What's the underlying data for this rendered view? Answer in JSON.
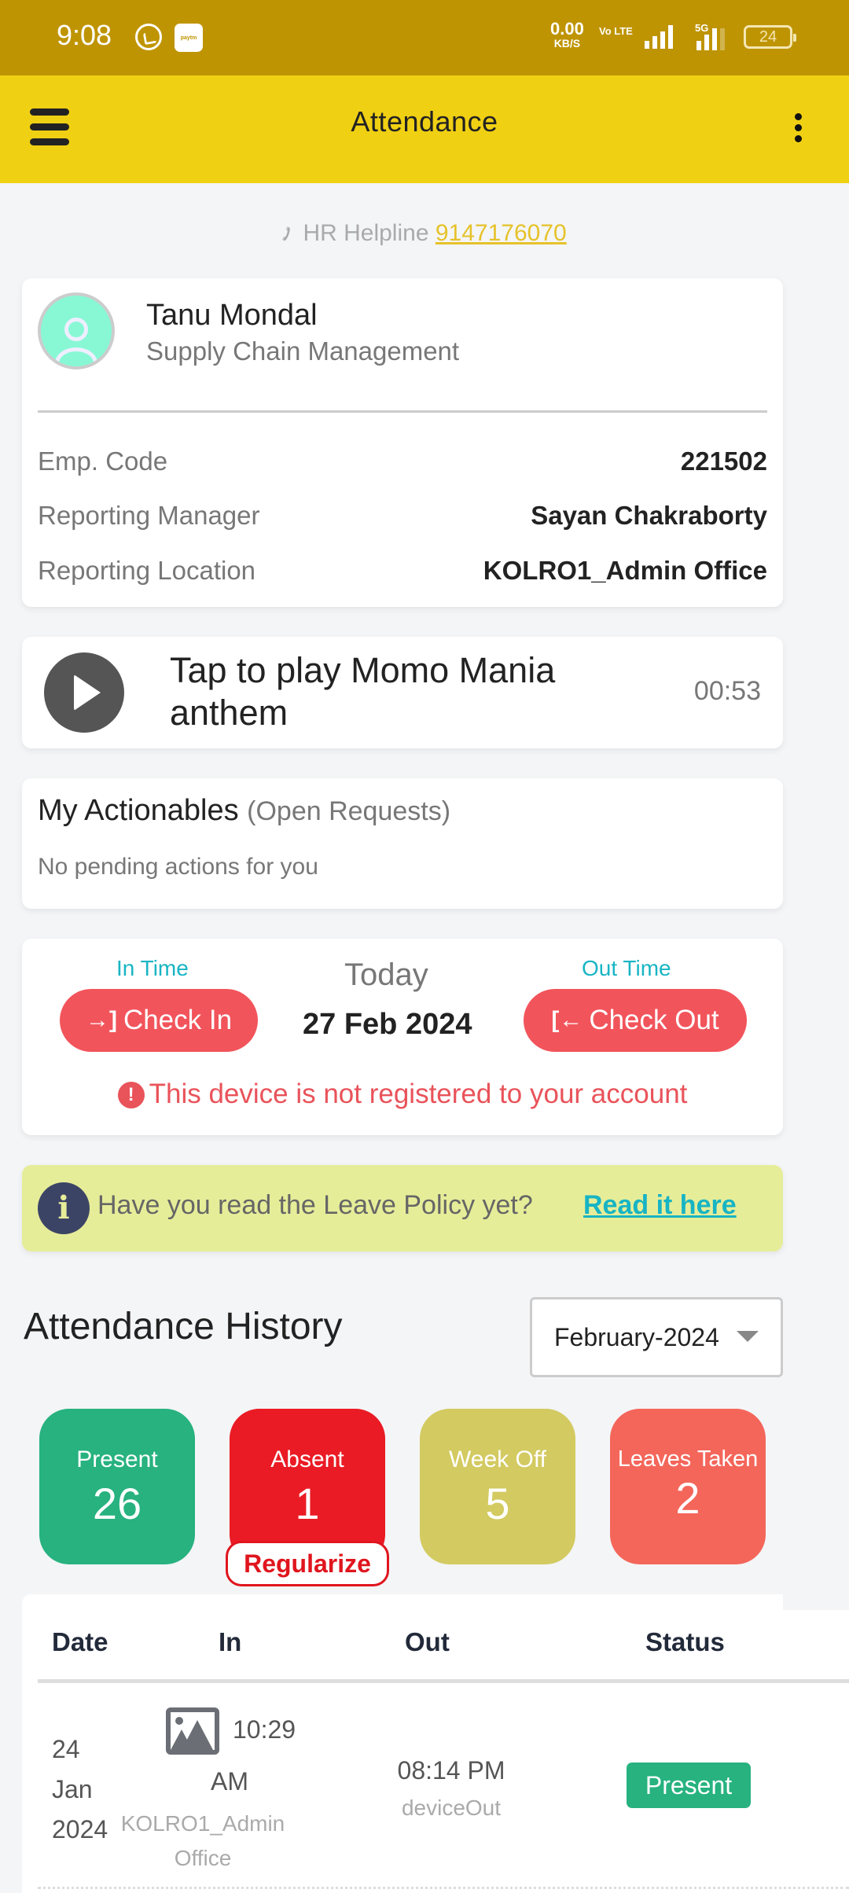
{
  "status_bar": {
    "time": "9:08",
    "notification_icons": [
      "whatsapp-icon",
      "paytm-icon"
    ],
    "paytm_label": "paytm",
    "net_speed_value": "0.00",
    "net_speed_unit": "KB/S",
    "volte_label": "Vo LTE",
    "network_label": "5G",
    "battery_level": "24"
  },
  "app_bar": {
    "title": "Attendance",
    "menu_icon": "hamburger-menu-icon",
    "overflow_icon": "more-vertical-icon"
  },
  "helpline": {
    "label": "HR Helpline",
    "number": "9147176070"
  },
  "profile": {
    "name": "Tanu Mondal",
    "department": "Supply Chain Management",
    "rows": [
      {
        "label": "Emp. Code",
        "value": "221502"
      },
      {
        "label": "Reporting Manager",
        "value": "Sayan Chakraborty"
      },
      {
        "label": "Reporting Location",
        "value": "KOLRO1_Admin Office"
      }
    ]
  },
  "anthem": {
    "text": "Tap to play Momo Mania anthem",
    "duration": "00:53"
  },
  "actionables": {
    "title": "My Actionables",
    "subtitle": "(Open Requests)",
    "empty_message": "No pending actions for you"
  },
  "check": {
    "in_label": "In Time",
    "out_label": "Out Time",
    "today_label": "Today",
    "date": "27 Feb 2024",
    "check_in_button": "Check In",
    "check_out_button": "Check Out",
    "warning": "This device is not registered to your account"
  },
  "policy_banner": {
    "text": "Have you read the Leave Policy yet?",
    "link": "Read it here"
  },
  "history": {
    "title": "Attendance History",
    "selected_month": "February-2024",
    "stats": [
      {
        "label": "Present",
        "value": "26",
        "color": "#27b27f"
      },
      {
        "label": "Absent",
        "value": "1",
        "color": "#ea1b24"
      },
      {
        "label": "Week Off",
        "value": "5",
        "color": "#d3ca61"
      },
      {
        "label": "Leaves Taken",
        "value": "2",
        "color": "#f4665a"
      }
    ],
    "regularize_button": "Regularize",
    "table": {
      "headers": [
        "Date",
        "In",
        "Out",
        "Status"
      ],
      "rows": [
        {
          "date_day": "24",
          "date_month": "Jan",
          "date_year": "2024",
          "in_time_part1": "10:29",
          "in_time_part2": "AM",
          "in_location": "KOLRO1_Admin Office",
          "out_time": "08:14 PM",
          "out_source": "deviceOut",
          "status": "Present",
          "status_color": "#27b27f"
        }
      ]
    }
  },
  "colors": {
    "status_bar": "#bf9402",
    "app_bar": "#f0d013",
    "accent_red": "#f2545b",
    "accent_cyan": "#18b5c4",
    "helpline_link": "#e6c22a",
    "policy_bg": "#e6ed99"
  }
}
